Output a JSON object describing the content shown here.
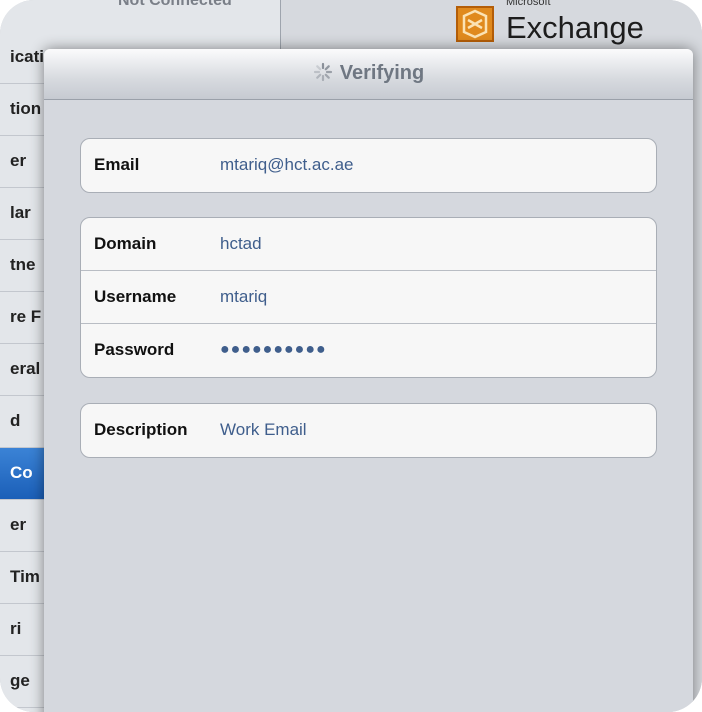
{
  "background": {
    "top_status": "Not Connected",
    "list_items": [
      "icati",
      "tion",
      "er",
      "lar",
      "tne",
      "re F",
      "eral",
      "d",
      "Co",
      "er",
      "Tim",
      "ri",
      "ge"
    ],
    "selected_index": 8,
    "logo": {
      "small": "Microsoft",
      "big": "Exchange"
    }
  },
  "sheet": {
    "title": "Verifying",
    "email": {
      "label": "Email",
      "value": "mtariq@hct.ac.ae"
    },
    "domain": {
      "label": "Domain",
      "value": "hctad"
    },
    "username": {
      "label": "Username",
      "value": "mtariq"
    },
    "password": {
      "label": "Password",
      "value": "●●●●●●●●●●"
    },
    "description": {
      "label": "Description",
      "value": "Work Email"
    }
  },
  "colors": {
    "value_text": "#3f5e8c",
    "selected_row": "#2a70c8",
    "logo_mark": "#e08a1e"
  }
}
